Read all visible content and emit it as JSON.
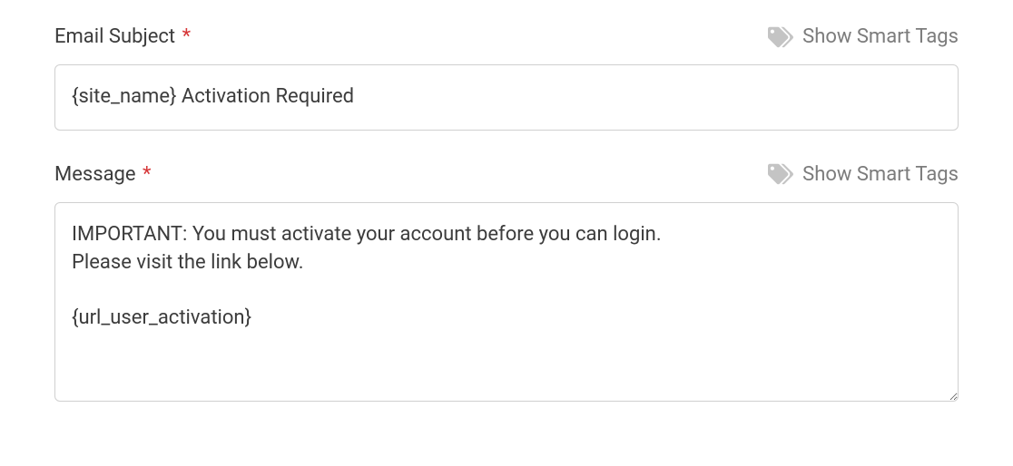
{
  "subject": {
    "label": "Email Subject",
    "smart_tags_label": "Show Smart Tags",
    "value": "{site_name} Activation Required"
  },
  "message": {
    "label": "Message",
    "smart_tags_label": "Show Smart Tags",
    "value": "IMPORTANT: You must activate your account before you can login.\nPlease visit the link below.\n\n{url_user_activation}"
  }
}
